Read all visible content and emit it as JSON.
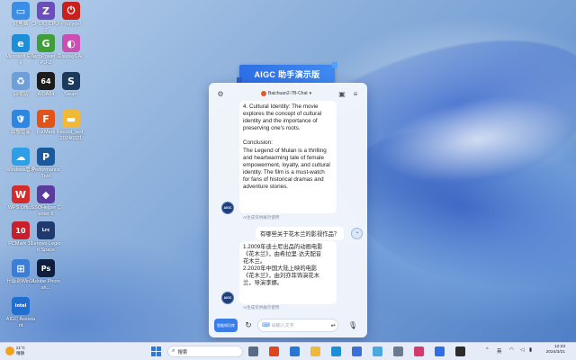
{
  "desktop": {
    "icons": [
      {
        "label": "此电脑",
        "icon": "computer-icon",
        "color": "#3a8ee6",
        "glyph": "▭"
      },
      {
        "label": "CPUID CPU-Z",
        "icon": "cpu-z-icon",
        "color": "#6b4fb8",
        "glyph": "Z"
      },
      {
        "label": "ProcyonI",
        "icon": "procyon-icon",
        "color": "#c8201e",
        "glyph": "⏻"
      },
      {
        "label": "Microsoft Edge",
        "icon": "edge-icon",
        "color": "#1d8fd6",
        "glyph": "e"
      },
      {
        "label": "TechPower GPU-Z",
        "icon": "gpu-z-icon",
        "color": "#3f9e3a",
        "glyph": "G"
      },
      {
        "label": "DisplayCAL",
        "icon": "displaycal-icon",
        "color": "#c94fb3",
        "glyph": "◐"
      },
      {
        "label": "回收站",
        "icon": "recycle-bin-icon",
        "color": "#6f9fd8",
        "glyph": "♻"
      },
      {
        "label": "AIDA64",
        "icon": "aida64-icon",
        "color": "#1c1c1c",
        "glyph": "64"
      },
      {
        "label": "Steam",
        "icon": "steam-icon",
        "color": "#1b3a5c",
        "glyph": "S"
      },
      {
        "label": "联想管家",
        "icon": "security-icon",
        "color": "#2f86e0",
        "glyph": "🛡"
      },
      {
        "label": "FurMark",
        "icon": "furmark-icon",
        "color": "#e0541b",
        "glyph": "F"
      },
      {
        "label": "Record_test_20240321",
        "icon": "folder-icon",
        "color": "#f0b93a",
        "glyph": "▬"
      },
      {
        "label": "Windows管理",
        "icon": "cloud-icon",
        "color": "#2e9fe6",
        "glyph": "☁"
      },
      {
        "label": "PerformanceTest",
        "icon": "performancetest-icon",
        "color": "#1a5a9c",
        "glyph": "P"
      },
      {
        "label": "WPS Office",
        "icon": "wps-icon",
        "color": "#d42b2b",
        "glyph": "W"
      },
      {
        "label": "SSOHelper Center 6",
        "icon": "ssohelper-icon",
        "color": "#5b3c9e",
        "glyph": "◆"
      },
      {
        "label": "PCMark 10",
        "icon": "pcmark-icon",
        "color": "#c91f2b",
        "glyph": "10"
      },
      {
        "label": "Lenovo Legion Space",
        "icon": "lrc-icon",
        "color": "#1e3a6e",
        "glyph": "Lrc"
      },
      {
        "label": "升级到Win11",
        "icon": "windows-icon",
        "color": "#3c7ed6",
        "glyph": "⊞"
      },
      {
        "label": "Adobe Photosh...",
        "icon": "photoshop-icon",
        "color": "#0d1f3c",
        "glyph": "Ps"
      },
      {
        "label": "AIGC Assistant",
        "icon": "intel-icon",
        "color": "#1f6fd0",
        "glyph": "intel"
      }
    ]
  },
  "banner": {
    "title": "AIGC 助手演示版"
  },
  "chat": {
    "model_label": "Baichuan2-7B-Chat",
    "ai_reply_1": "4. Cultural Identity: The movie\nexplores the concept of cultural\nidentity and the importance of\npreserving one's roots.\n\nConclusion:\nThe Legend of Mulan is a thrilling\nand heartwarming tale of female\nempowerment, loyalty, and cultural\nidentity. The film is a must-watch\nfor fans of historical dramas and\nadventure stories.",
    "ai_note": "AI生成仅供展示使用",
    "user_question": "有哪些关于花木兰的影视作品？",
    "ai_reply_2": "1.2009年迪士尼出品的动画电影\n《花木兰》，由希拉里·达夫配音\n花木兰。\n2.2020年中国大陆上映的电影\n《花木兰》，由刘亦菲饰演花木\n兰，导演李娜。",
    "avatar_text": "AIGC",
    "input_placeholder": "请输入文字",
    "kb_button": "智能知识库"
  },
  "taskbar": {
    "temperature": "21°C",
    "weather": "晴朗",
    "search_label": "搜索",
    "lang": "英",
    "time": "12:23",
    "date": "2024/3/21",
    "apps": [
      {
        "icon": "task-view-icon",
        "color": "#5a6b86"
      },
      {
        "icon": "browser-icon",
        "color": "#e0451f"
      },
      {
        "icon": "mail-icon",
        "color": "#2a76d2"
      },
      {
        "icon": "explorer-icon",
        "color": "#f0b93a"
      },
      {
        "icon": "edge-icon",
        "color": "#1d8fd6"
      },
      {
        "icon": "store-icon",
        "color": "#3a6fd8"
      },
      {
        "icon": "photos-icon",
        "color": "#4aa7e0"
      },
      {
        "icon": "settings-icon",
        "color": "#6b7a90"
      },
      {
        "icon": "media-icon",
        "color": "#d23b6a"
      },
      {
        "icon": "aigc-icon",
        "color": "#2e6fe6"
      },
      {
        "icon": "terminal-icon",
        "color": "#2c2c2c"
      }
    ]
  }
}
